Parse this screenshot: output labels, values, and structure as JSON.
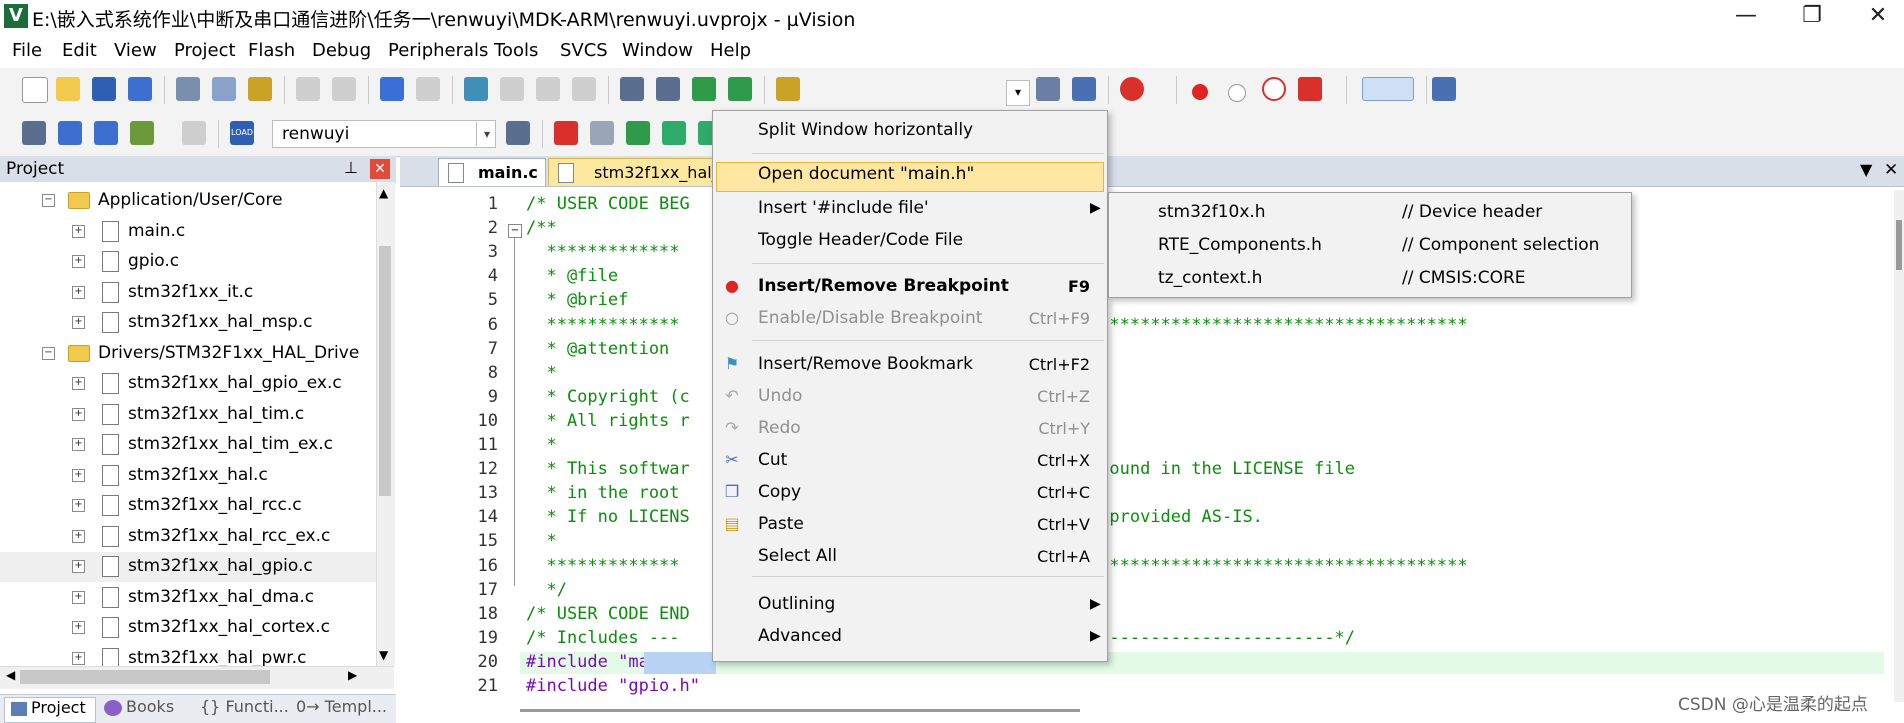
{
  "window": {
    "title": "E:\\嵌入式系统作业\\中断及串口通信进阶\\任务一\\renwuyi\\MDK-ARM\\renwuyi.uvprojx - µVision",
    "app_icon": "V",
    "minimize": "—",
    "maximize": "❐",
    "close": "✕"
  },
  "menu": [
    "File",
    "Edit",
    "View",
    "Project",
    "Flash",
    "Debug",
    "Peripherals",
    "Tools",
    "SVCS",
    "Window",
    "Help"
  ],
  "toolbar2": {
    "target": "renwuyi",
    "load_label": "LOAD"
  },
  "project_panel": {
    "title": "Project",
    "pin": "⊥",
    "close": "✕",
    "tree": [
      {
        "type": "folder",
        "label": "Application/User/Core",
        "sign": "−"
      },
      {
        "type": "file",
        "label": "main.c",
        "sign": "+"
      },
      {
        "type": "file",
        "label": "gpio.c",
        "sign": "+"
      },
      {
        "type": "file",
        "label": "stm32f1xx_it.c",
        "sign": "+"
      },
      {
        "type": "file",
        "label": "stm32f1xx_hal_msp.c",
        "sign": "+"
      },
      {
        "type": "folder",
        "label": "Drivers/STM32F1xx_HAL_Drive",
        "sign": "−"
      },
      {
        "type": "file",
        "label": "stm32f1xx_hal_gpio_ex.c",
        "sign": "+"
      },
      {
        "type": "file",
        "label": "stm32f1xx_hal_tim.c",
        "sign": "+"
      },
      {
        "type": "file",
        "label": "stm32f1xx_hal_tim_ex.c",
        "sign": "+"
      },
      {
        "type": "file",
        "label": "stm32f1xx_hal.c",
        "sign": "+"
      },
      {
        "type": "file",
        "label": "stm32f1xx_hal_rcc.c",
        "sign": "+"
      },
      {
        "type": "file",
        "label": "stm32f1xx_hal_rcc_ex.c",
        "sign": "+"
      },
      {
        "type": "file",
        "label": "stm32f1xx_hal_gpio.c",
        "sign": "+"
      },
      {
        "type": "file",
        "label": "stm32f1xx_hal_dma.c",
        "sign": "+"
      },
      {
        "type": "file",
        "label": "stm32f1xx_hal_cortex.c",
        "sign": "+"
      },
      {
        "type": "file",
        "label": "stm32f1xx_hal_pwr.c",
        "sign": "+"
      }
    ],
    "bottom_tabs": [
      "Project",
      "Books",
      "{} Functi...",
      "0→ Templ..."
    ]
  },
  "editor": {
    "tabs": [
      "main.c",
      "stm32f1xx_hal_"
    ],
    "dropdown": "▼",
    "close": "✕",
    "lines": [
      {
        "n": "1",
        "text": "/* USER CODE BEG",
        "kind": "comment"
      },
      {
        "n": "2",
        "text": "/**",
        "kind": "comment"
      },
      {
        "n": "3",
        "text": "  *************",
        "kind": "comment"
      },
      {
        "n": "4",
        "text": "  * @file",
        "kind": "comment"
      },
      {
        "n": "5",
        "text": "  * @brief",
        "kind": "comment"
      },
      {
        "n": "6",
        "text": "  *************                                     ****************************************",
        "kind": "comment"
      },
      {
        "n": "7",
        "text": "  * @attention",
        "kind": "comment"
      },
      {
        "n": "8",
        "text": "  *",
        "kind": "comment"
      },
      {
        "n": "9",
        "text": "  * Copyright (c",
        "kind": "comment"
      },
      {
        "n": "10",
        "text": "  * All rights r",
        "kind": "comment"
      },
      {
        "n": "11",
        "text": "  *",
        "kind": "comment"
      },
      {
        "n": "12",
        "text": "  * This softwar                                   n be found in the LICENSE file",
        "kind": "comment"
      },
      {
        "n": "13",
        "text": "  * in the root                                    ent.",
        "kind": "comment"
      },
      {
        "n": "14",
        "text": "  * If no LICENS                                   it is provided AS-IS.",
        "kind": "comment"
      },
      {
        "n": "15",
        "text": "  *",
        "kind": "comment"
      },
      {
        "n": "16",
        "text": "  *************                                     ****************************************",
        "kind": "comment"
      },
      {
        "n": "17",
        "text": "  */",
        "kind": "comment"
      },
      {
        "n": "18",
        "text": "/* USER CODE END",
        "kind": "comment"
      },
      {
        "n": "19",
        "text": "/* Includes ---                                   -----------------------------*/",
        "kind": "comment"
      },
      {
        "n": "20",
        "text": "#include \"main.h\"",
        "kind": "pp"
      },
      {
        "n": "21",
        "text": "#include \"gpio.h\"",
        "kind": "pp"
      }
    ]
  },
  "context_menu": {
    "items": [
      {
        "label": "Split Window horizontally",
        "shortcut": "",
        "disabled": false
      },
      {
        "label": "Open document \"main.h\"",
        "shortcut": "",
        "disabled": false,
        "highlight": true
      },
      {
        "label": "Insert '#include file'",
        "shortcut": "",
        "disabled": false,
        "submenu": true
      },
      {
        "label": "Toggle Header/Code File",
        "shortcut": "",
        "disabled": false
      },
      {
        "label": "Insert/Remove Breakpoint",
        "shortcut": "F9",
        "disabled": false,
        "bold": true
      },
      {
        "label": "Enable/Disable Breakpoint",
        "shortcut": "Ctrl+F9",
        "disabled": true
      },
      {
        "label": "Insert/Remove Bookmark",
        "shortcut": "Ctrl+F2",
        "disabled": false
      },
      {
        "label": "Undo",
        "shortcut": "Ctrl+Z",
        "disabled": true
      },
      {
        "label": "Redo",
        "shortcut": "Ctrl+Y",
        "disabled": true
      },
      {
        "label": "Cut",
        "shortcut": "Ctrl+X",
        "disabled": false
      },
      {
        "label": "Copy",
        "shortcut": "Ctrl+C",
        "disabled": false
      },
      {
        "label": "Paste",
        "shortcut": "Ctrl+V",
        "disabled": false
      },
      {
        "label": "Select All",
        "shortcut": "Ctrl+A",
        "disabled": false
      },
      {
        "label": "Outlining",
        "shortcut": "",
        "disabled": false,
        "submenu": true
      },
      {
        "label": "Advanced",
        "shortcut": "",
        "disabled": false,
        "submenu": true
      }
    ],
    "submenu_arrow": "▶"
  },
  "include_submenu": [
    {
      "file": "stm32f10x.h",
      "comment": "// Device header"
    },
    {
      "file": "RTE_Components.h",
      "comment": "// Component selection"
    },
    {
      "file": "tz_context.h",
      "comment": "// CMSIS:CORE"
    }
  ],
  "watermark": "CSDN @心是温柔的起点",
  "colors": {
    "comment": "#0a8f0a",
    "preprocessor": "#7a0ab8",
    "menu_highlight": "#fde7a3",
    "breakpoint": "#e02424"
  }
}
